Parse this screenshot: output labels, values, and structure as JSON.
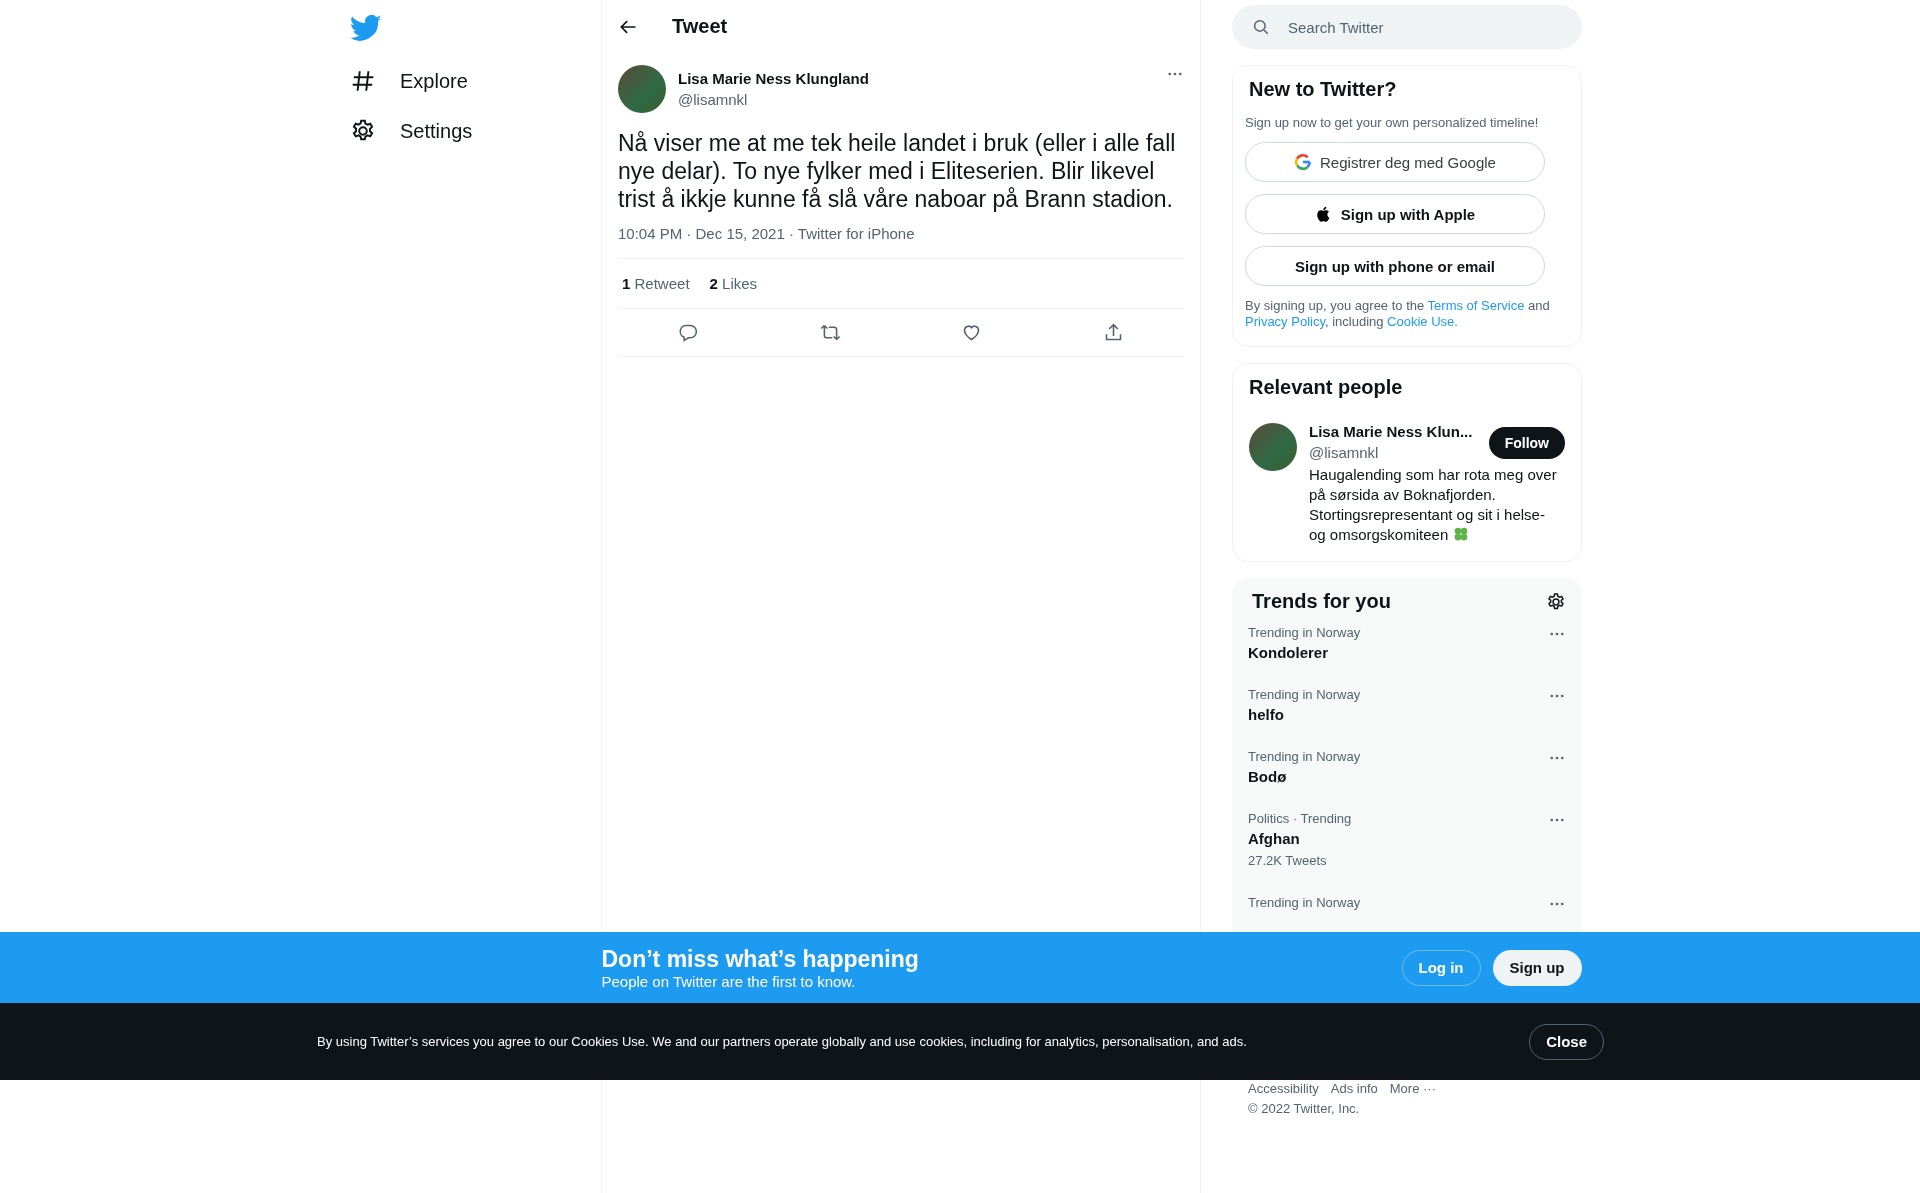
{
  "sidebar": {
    "items": [
      {
        "label": "Explore"
      },
      {
        "label": "Settings"
      }
    ]
  },
  "header": {
    "title": "Tweet"
  },
  "tweet": {
    "author": {
      "name": "Lisa Marie Ness Klungland",
      "handle": "@lisamnkl"
    },
    "text": "Nå viser me at me tek heile landet i bruk (eller i alle fall nye delar). To nye fylker med i Eliteserien. Blir likevel trist å ikkje kunne få slå våre naboar på Brann stadion.",
    "meta": "10:04 PM · Dec 15, 2021 · Twitter for iPhone",
    "stats": [
      {
        "count": "1",
        "label": "Retweet"
      },
      {
        "count": "2",
        "label": "Likes"
      }
    ],
    "actions": [
      {
        "kind": "reply"
      },
      {
        "kind": "retweet"
      },
      {
        "kind": "like"
      },
      {
        "kind": "share"
      }
    ]
  },
  "search": {
    "placeholder": "Search Twitter"
  },
  "signup": {
    "title": "New to Twitter?",
    "subtitle": "Sign up now to get your own personalized timeline!",
    "buttons": [
      {
        "kind": "google",
        "label": "Registrer deg med Google"
      },
      {
        "kind": "apple",
        "label": "Sign up with Apple"
      },
      {
        "kind": "plain",
        "label": "Sign up with phone or email"
      }
    ],
    "legal": [
      {
        "text": "By signing up, you agree to the ",
        "link": false
      },
      {
        "text": "Terms of Service",
        "link": true
      },
      {
        "text": " and ",
        "link": false
      },
      {
        "text": "Privacy Policy",
        "link": true
      },
      {
        "text": ", including ",
        "link": false
      },
      {
        "text": "Cookie Use.",
        "link": true
      }
    ]
  },
  "relevant_people": {
    "title": "Relevant people",
    "people": [
      {
        "name": "Lisa Marie Ness Klun...",
        "handle": "@lisamnkl",
        "bio": "Haugalending som har rota meg over på sørsida av Boknafjorden. Stortingsrepresentant og sit i helse- og omsorgskomiteen",
        "button": "Follow"
      }
    ]
  },
  "trends": {
    "title": "Trends for you",
    "items": [
      {
        "category": "Trending in Norway",
        "name": "Kondolerer"
      },
      {
        "category": "Trending in Norway",
        "name": "helfo"
      },
      {
        "category": "Trending in Norway",
        "name": "Bodø"
      },
      {
        "category": "Politics · Trending",
        "name": "Afghan",
        "count": "27.2K Tweets"
      },
      {
        "category": "Trending in Norway"
      }
    ]
  },
  "footer": {
    "links": [
      "Accessibility",
      "Ads info",
      "More ···"
    ],
    "copyright": "© 2022 Twitter, Inc."
  },
  "banner": {
    "title": "Don’t miss what’s happening",
    "subtitle": "People on Twitter are the first to know.",
    "login": "Log in",
    "signup": "Sign up"
  },
  "cookie_bar": {
    "text": "By using Twitter’s services you agree to our Cookies Use. We and our partners operate globally and use cookies, including for analytics, personalisation, and ads.",
    "button": "Close"
  }
}
